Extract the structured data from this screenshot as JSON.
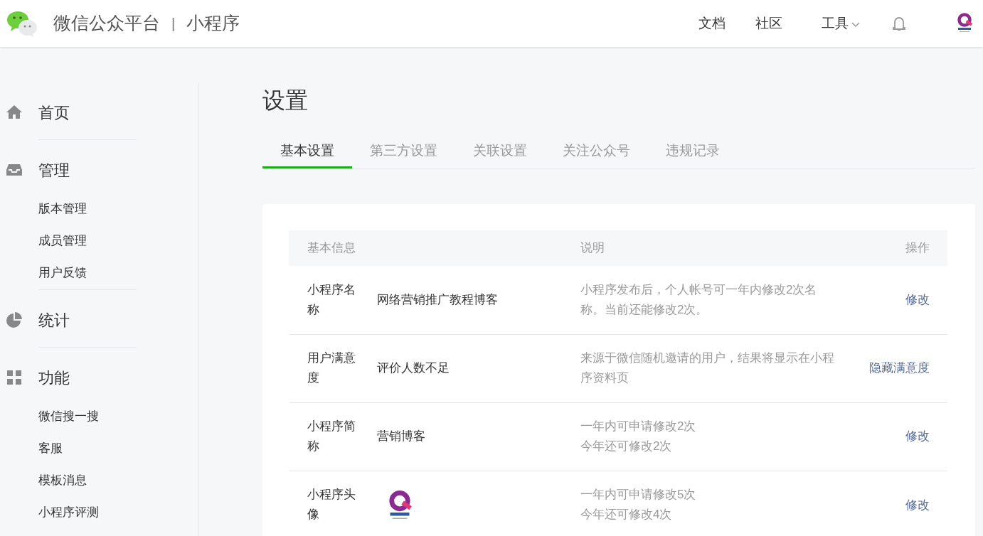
{
  "header": {
    "brand": "微信公众平台",
    "separator": "|",
    "product": "小程序",
    "nav": [
      {
        "label": "文档",
        "kind": "link"
      },
      {
        "label": "社区",
        "kind": "link"
      },
      {
        "label": "工具",
        "kind": "dropdown"
      }
    ]
  },
  "sidebar": {
    "sections": [
      {
        "label": "首页"
      },
      {
        "label": "管理",
        "children": [
          {
            "label": "版本管理"
          },
          {
            "label": "成员管理"
          },
          {
            "label": "用户反馈"
          }
        ]
      },
      {
        "label": "统计"
      },
      {
        "label": "功能",
        "children": [
          {
            "label": "微信搜一搜"
          },
          {
            "label": "客服"
          },
          {
            "label": "模板消息"
          },
          {
            "label": "小程序评测"
          }
        ]
      }
    ]
  },
  "page_title": "设置",
  "tabs": [
    {
      "label": "基本设置",
      "selected": true
    },
    {
      "label": "第三方设置",
      "selected": false
    },
    {
      "label": "关联设置",
      "selected": false
    },
    {
      "label": "关注公众号",
      "selected": false
    },
    {
      "label": "违规记录",
      "selected": false
    }
  ],
  "table": {
    "columns": [
      "基本信息",
      "说明",
      "操作"
    ],
    "rows": [
      {
        "label": "小程序名称",
        "kind": "text",
        "value": "网络营销推广教程博客",
        "description": [
          "小程序发布后，个人帐号可一年内修改2次名称。当前还能修改2次。"
        ],
        "action": "修改"
      },
      {
        "label": "用户满意度",
        "kind": "text",
        "value": "评价人数不足",
        "description": [
          "来源于微信随机邀请的用户，结果将显示在小程序资料页"
        ],
        "action": "隐藏满意度"
      },
      {
        "label": "小程序简称",
        "kind": "text",
        "value": "营销博客",
        "description": [
          "一年内可申请修改2次",
          "今年还可修改2次"
        ],
        "action": "修改"
      },
      {
        "label": "小程序头像",
        "kind": "logo",
        "description": [
          "一年内可申请修改5次",
          "今年还可修改4次"
        ],
        "action": "修改"
      }
    ]
  }
}
